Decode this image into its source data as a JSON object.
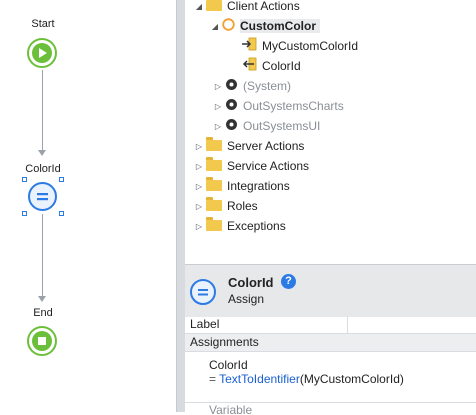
{
  "flow": {
    "start_label": "Start",
    "assign_label": "ColorId",
    "end_label": "End"
  },
  "tree": {
    "client_actions": "Client Actions",
    "custom_color": "CustomColor",
    "input_param": "MyCustomColorId",
    "output_param": "ColorId",
    "system": "(System)",
    "outsystems_charts": "OutSystemsCharts",
    "outsystems_ui": "OutSystemsUI",
    "server_actions": "Server Actions",
    "service_actions": "Service Actions",
    "integrations": "Integrations",
    "roles": "Roles",
    "exceptions": "Exceptions"
  },
  "properties": {
    "title": "ColorId",
    "subtitle": "Assign",
    "help_glyph": "?",
    "label_field": "Label",
    "label_value": "",
    "assignments_header": "Assignments",
    "assign_variable": "ColorId",
    "assign_eq": "= ",
    "assign_function": "TextToIdentifier",
    "assign_args": "(MyCustomColorId)",
    "next_field_partial": "Variable"
  },
  "colors": {
    "start_green": "#6cbf3a",
    "assign_blue": "#2c7be5",
    "help_blue": "#2c7be5",
    "function_blue": "#1a5fd0",
    "folder_yellow": "#f2c94c"
  },
  "icons": {
    "start": "play-icon",
    "assign": "assign-icon",
    "end": "stop-icon",
    "folder": "folder-icon",
    "action": "client-action-icon",
    "input": "input-parameter-icon",
    "output": "output-parameter-icon",
    "module": "module-reference-icon",
    "help": "help-icon"
  }
}
